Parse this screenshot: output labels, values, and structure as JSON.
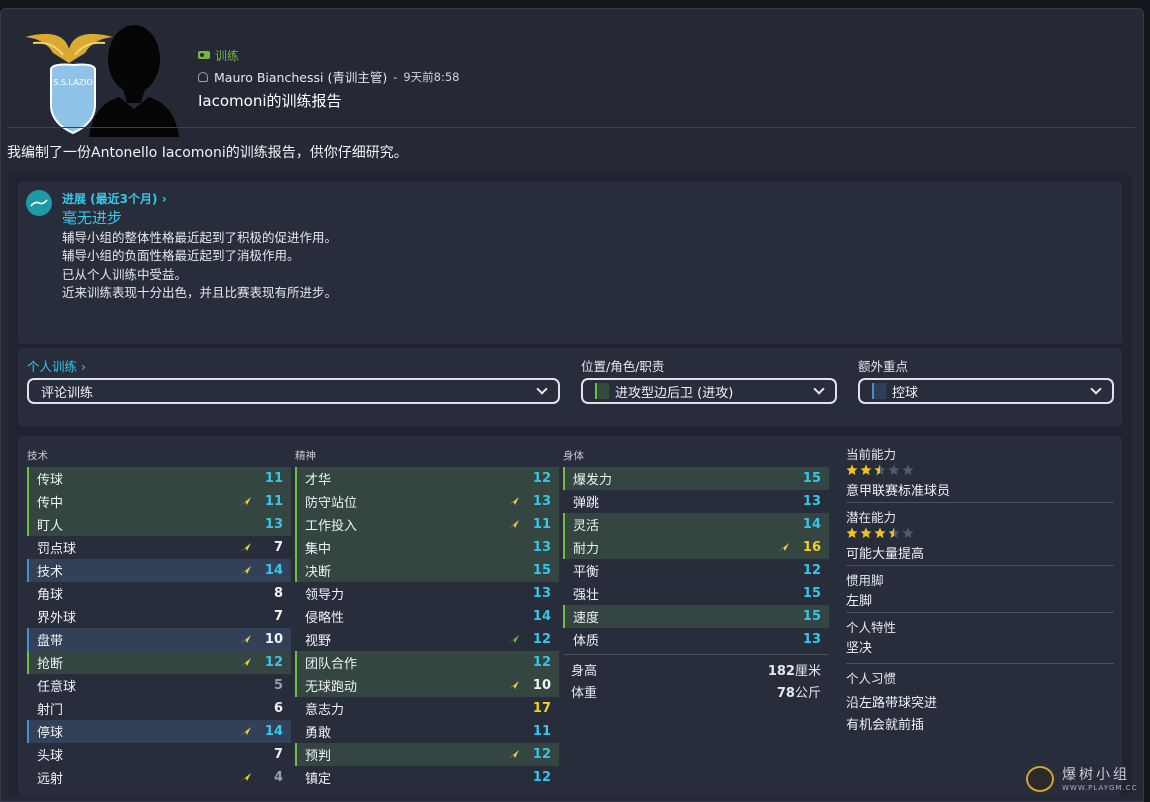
{
  "header": {
    "tag": "训练",
    "sender": "Mauro Bianchessi (青训主管)",
    "time_sep": "-",
    "time": "9天前8:58",
    "title": "Iacomoni的训练报告",
    "badge_text": "S.S.LAZIO"
  },
  "intro": "我编制了一份Antonello Iacomoni的训练报告，供你仔细研究。",
  "progress": {
    "heading": "进展 (最近3个月)",
    "status": "毫无进步",
    "lines": [
      "辅导小组的整体性格最近起到了积极的促进作用。",
      "辅导小组的负面性格最近起到了消极作用。",
      "已从个人训练中受益。",
      "近来训练表现十分出色，并且比赛表现有所进步。"
    ]
  },
  "selectors": {
    "individual": {
      "label": "个人训练",
      "value": "评论训练"
    },
    "position": {
      "label": "位置/角色/职责",
      "value": "进攻型边后卫 (进攻)"
    },
    "extra": {
      "label": "额外重点",
      "value": "控球"
    }
  },
  "attributes": {
    "technical_label": "技术",
    "mental_label": "精神",
    "physical_label": "身体",
    "technical": [
      {
        "name": "传球",
        "value": "11",
        "hl": "green",
        "arrow": "",
        "color": "cyan"
      },
      {
        "name": "传中",
        "value": "11",
        "hl": "green",
        "arrow": "yellow",
        "color": "cyan"
      },
      {
        "name": "盯人",
        "value": "13",
        "hl": "green",
        "arrow": "",
        "color": "cyan"
      },
      {
        "name": "罚点球",
        "value": "7",
        "hl": "",
        "arrow": "yellow",
        "color": "white"
      },
      {
        "name": "技术",
        "value": "14",
        "hl": "blue",
        "arrow": "yellow",
        "color": "cyan"
      },
      {
        "name": "角球",
        "value": "8",
        "hl": "",
        "arrow": "",
        "color": "white"
      },
      {
        "name": "界外球",
        "value": "7",
        "hl": "",
        "arrow": "",
        "color": "white"
      },
      {
        "name": "盘带",
        "value": "10",
        "hl": "blue",
        "arrow": "yellow",
        "color": "white"
      },
      {
        "name": "抢断",
        "value": "12",
        "hl": "green",
        "arrow": "yellow",
        "color": "cyan"
      },
      {
        "name": "任意球",
        "value": "5",
        "hl": "",
        "arrow": "",
        "color": "grey"
      },
      {
        "name": "射门",
        "value": "6",
        "hl": "",
        "arrow": "",
        "color": "white"
      },
      {
        "name": "停球",
        "value": "14",
        "hl": "blue",
        "arrow": "yellow",
        "color": "cyan"
      },
      {
        "name": "头球",
        "value": "7",
        "hl": "",
        "arrow": "",
        "color": "white"
      },
      {
        "name": "远射",
        "value": "4",
        "hl": "",
        "arrow": "yellow",
        "color": "grey"
      }
    ],
    "mental": [
      {
        "name": "才华",
        "value": "12",
        "hl": "green",
        "arrow": "",
        "color": "cyan"
      },
      {
        "name": "防守站位",
        "value": "13",
        "hl": "green",
        "arrow": "yellow",
        "color": "cyan"
      },
      {
        "name": "工作投入",
        "value": "11",
        "hl": "green",
        "arrow": "yellow",
        "color": "cyan"
      },
      {
        "name": "集中",
        "value": "13",
        "hl": "green",
        "arrow": "",
        "color": "cyan"
      },
      {
        "name": "决断",
        "value": "15",
        "hl": "green",
        "arrow": "",
        "color": "cyan"
      },
      {
        "name": "领导力",
        "value": "13",
        "hl": "",
        "arrow": "",
        "color": "cyan"
      },
      {
        "name": "侵略性",
        "value": "14",
        "hl": "",
        "arrow": "",
        "color": "cyan"
      },
      {
        "name": "视野",
        "value": "12",
        "hl": "",
        "arrow": "green",
        "color": "cyan"
      },
      {
        "name": "团队合作",
        "value": "12",
        "hl": "green",
        "arrow": "",
        "color": "cyan"
      },
      {
        "name": "无球跑动",
        "value": "10",
        "hl": "green",
        "arrow": "yellow",
        "color": "white"
      },
      {
        "name": "意志力",
        "value": "17",
        "hl": "",
        "arrow": "",
        "color": "yellow"
      },
      {
        "name": "勇敢",
        "value": "11",
        "hl": "",
        "arrow": "",
        "color": "cyan"
      },
      {
        "name": "预判",
        "value": "12",
        "hl": "green",
        "arrow": "yellow",
        "color": "cyan"
      },
      {
        "name": "镇定",
        "value": "12",
        "hl": "",
        "arrow": "",
        "color": "cyan"
      }
    ],
    "physical": [
      {
        "name": "爆发力",
        "value": "15",
        "hl": "green",
        "arrow": "",
        "color": "cyan"
      },
      {
        "name": "弹跳",
        "value": "13",
        "hl": "",
        "arrow": "",
        "color": "cyan"
      },
      {
        "name": "灵活",
        "value": "14",
        "hl": "green",
        "arrow": "",
        "color": "cyan"
      },
      {
        "name": "耐力",
        "value": "16",
        "hl": "green",
        "arrow": "yellow",
        "color": "yellow"
      },
      {
        "name": "平衡",
        "value": "12",
        "hl": "",
        "arrow": "",
        "color": "cyan"
      },
      {
        "name": "强壮",
        "value": "15",
        "hl": "",
        "arrow": "",
        "color": "cyan"
      },
      {
        "name": "速度",
        "value": "15",
        "hl": "green",
        "arrow": "",
        "color": "cyan"
      },
      {
        "name": "体质",
        "value": "13",
        "hl": "",
        "arrow": "",
        "color": "cyan"
      }
    ],
    "height": {
      "label": "身高",
      "value": "182",
      "unit": "厘米"
    },
    "weight": {
      "label": "体重",
      "value": "78",
      "unit": "公斤"
    }
  },
  "info": {
    "current_ability": {
      "label": "当前能力",
      "stars": 2.5,
      "desc": "意甲联赛标准球员"
    },
    "potential_ability": {
      "label": "潜在能力",
      "stars": 3.5,
      "desc": "可能大量提高"
    },
    "foot": {
      "label": "惯用脚",
      "value": "左脚"
    },
    "traits": {
      "label": "个人特性",
      "value": "坚决"
    },
    "habits": {
      "label": "个人习惯",
      "values": [
        "沿左路带球突进",
        "有机会就前插"
      ]
    }
  },
  "colors": {
    "accent_cyan": "#38c6e8",
    "tag_green": "#7cb342",
    "highlight_yellow": "#f5d020",
    "star_gold": "#f0c419"
  },
  "watermark": {
    "text": "爆树小组",
    "url": "WWW.PLAYGM.CC"
  }
}
